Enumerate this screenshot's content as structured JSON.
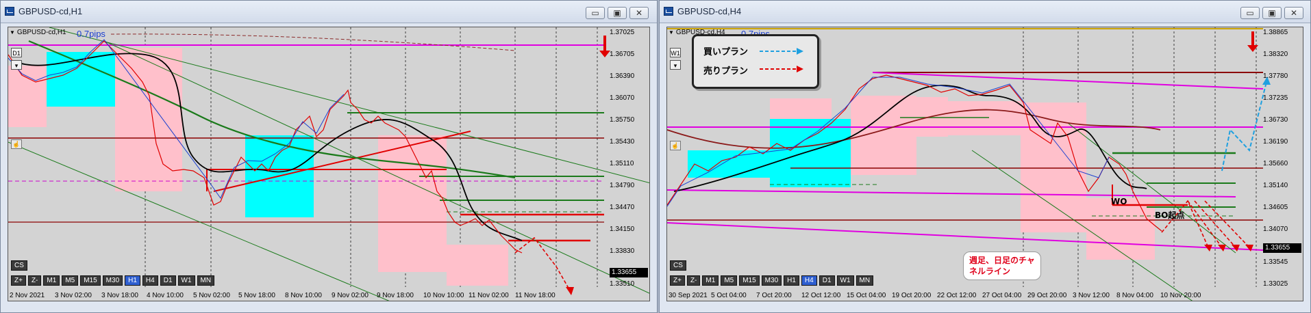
{
  "left": {
    "title": "GBPUSD-cd,H1",
    "symbol": "GBPUSD-cd,H1",
    "spread": "0.7pips",
    "tf_button": "D1",
    "prices": [
      "1.37025",
      "1.36705",
      "1.36390",
      "1.36070",
      "1.35750",
      "1.35430",
      "1.35110",
      "1.34790",
      "1.34470",
      "1.34150",
      "1.33830",
      "1.33510"
    ],
    "current_price": "1.33655",
    "dates": [
      "2 Nov 2021",
      "3 Nov 02:00",
      "3 Nov 18:00",
      "4 Nov 10:00",
      "5 Nov 02:00",
      "5 Nov 18:00",
      "8 Nov 10:00",
      "9 Nov 02:00",
      "9 Nov 18:00",
      "10 Nov 10:00",
      "11 Nov 02:00",
      "11 Nov 18:00"
    ]
  },
  "right": {
    "title": "GBPUSD-cd,H4",
    "symbol": "GBPUSD-cd,H4",
    "spread": "0.7pips",
    "tf_button": "W1",
    "prices": [
      "1.38865",
      "1.38320",
      "1.37780",
      "1.37235",
      "1.36730",
      "1.36190",
      "1.35660",
      "1.35140",
      "1.34605",
      "1.34070",
      "1.33545",
      "1.33025"
    ],
    "current_price": "1.33655",
    "dates": [
      "30 Sep 2021",
      "5 Oct 04:00",
      "7 Oct 20:00",
      "12 Oct 12:00",
      "15 Oct 04:00",
      "19 Oct 20:00",
      "22 Oct 12:00",
      "27 Oct 04:00",
      "29 Oct 20:00",
      "3 Nov 12:00",
      "8 Nov 04:00",
      "10 Nov 20:00"
    ],
    "legend": {
      "buy": "買いプラン",
      "sell": "売りプラン"
    },
    "wo": "WO",
    "bo": "BO起点",
    "callout": [
      "週足、日足のチャ",
      "ネルライン"
    ]
  },
  "cs_label": "CS",
  "timeframes": [
    "Z+",
    "Z-",
    "M1",
    "M5",
    "M15",
    "M30",
    "H1",
    "H4",
    "D1",
    "W1",
    "MN"
  ],
  "colors": {
    "bg": "#d3d3d3",
    "magenta": "#e000e0",
    "cyan": "#00ffff",
    "pink": "#ffc0cb",
    "red": "#e00000",
    "green": "#1a7a1a",
    "darkred": "#8b0000"
  }
}
